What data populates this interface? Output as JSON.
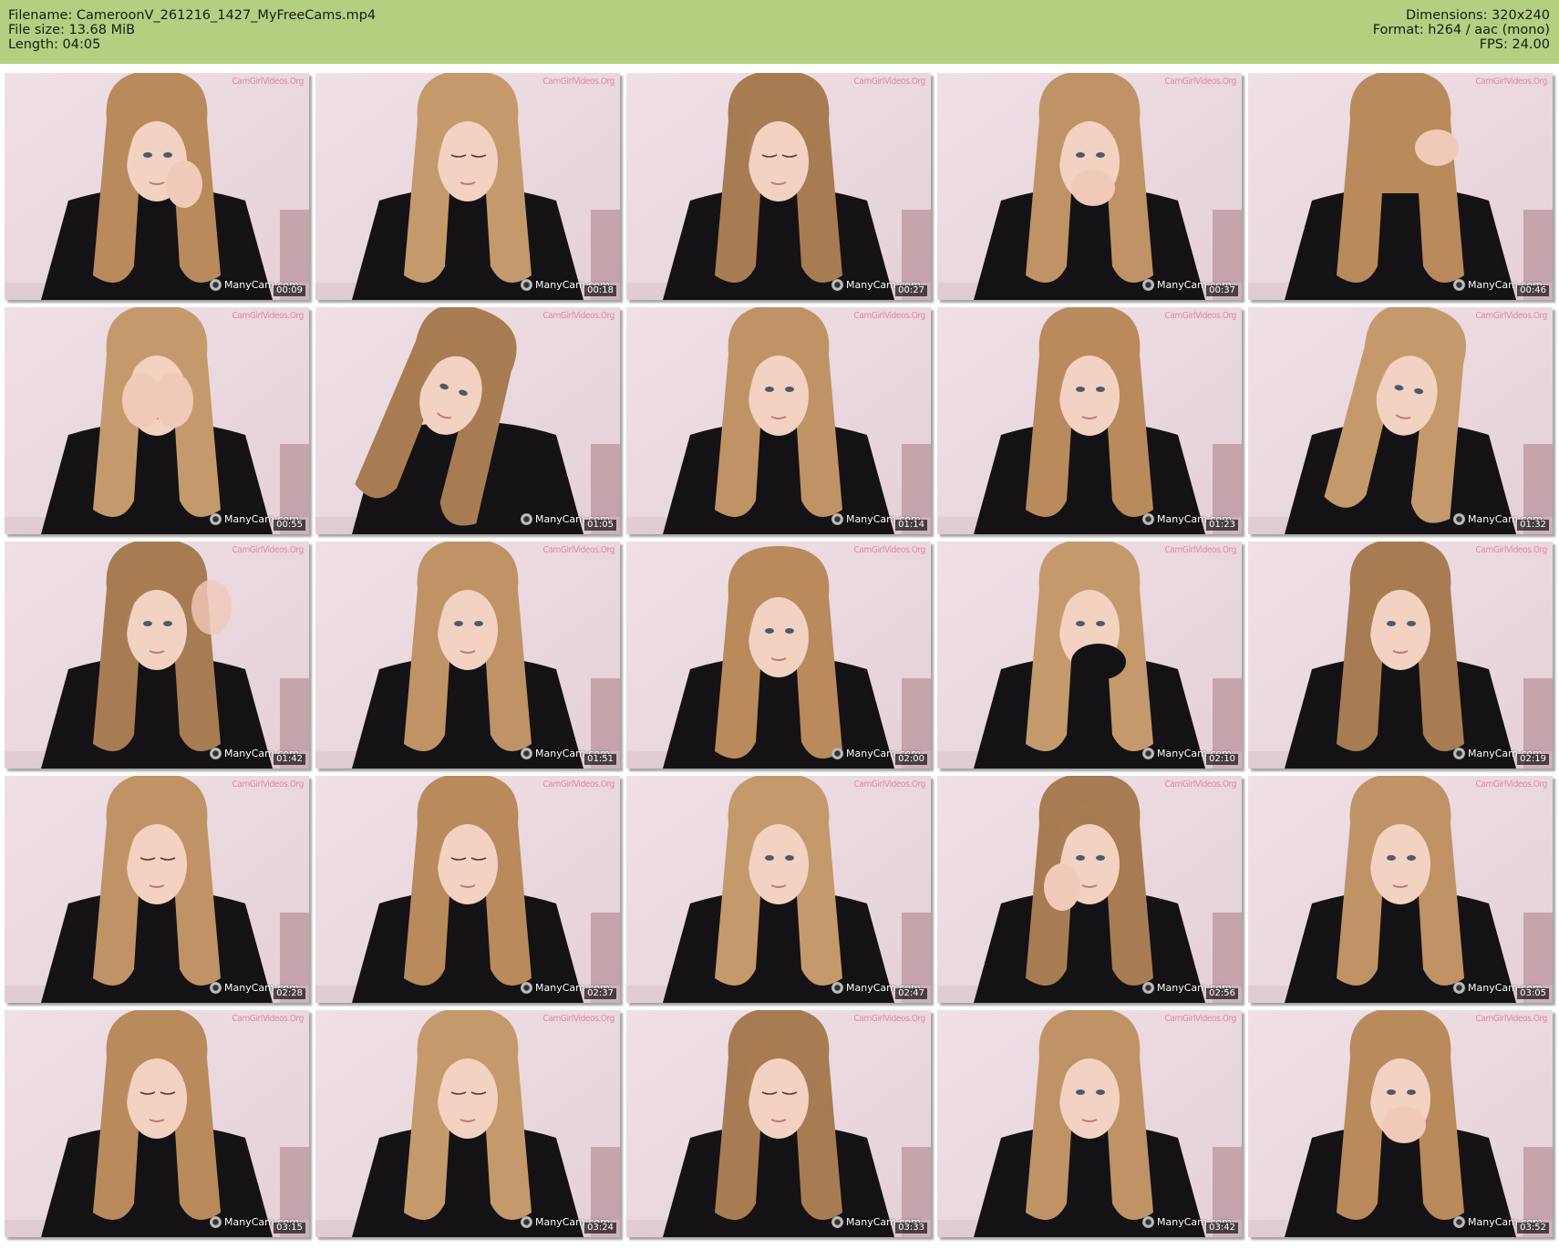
{
  "header": {
    "filename_line": "Filename: CameroonV_261216_1427_MyFreeCams.mp4",
    "filesize_line": "File size: 13.68 MiB",
    "length_line": "Length: 04:05",
    "dimensions_line": "Dimensions: 320x240",
    "format_line": "Format: h264 / aac (mono)",
    "fps_line": "FPS: 24.00",
    "bar_color": "#b3cf80"
  },
  "watermarks": {
    "top": "CamGirlVideos.Org",
    "bottom": "ManyCam.com"
  },
  "grid": {
    "columns": 5,
    "rows": 5
  },
  "thumbnails": [
    {
      "time": "00:09",
      "pose": "hand-cheek-right"
    },
    {
      "time": "00:18",
      "pose": "looking-down"
    },
    {
      "time": "00:27",
      "pose": "looking-down"
    },
    {
      "time": "00:37",
      "pose": "hand-mouth"
    },
    {
      "time": "00:46",
      "pose": "head-down-hand-hair"
    },
    {
      "time": "00:55",
      "pose": "hands-face"
    },
    {
      "time": "01:05",
      "pose": "hand-hair-tilt"
    },
    {
      "time": "01:14",
      "pose": "frontal"
    },
    {
      "time": "01:23",
      "pose": "frontal"
    },
    {
      "time": "01:32",
      "pose": "smile-tilt"
    },
    {
      "time": "01:42",
      "pose": "hand-hair-raised"
    },
    {
      "time": "01:51",
      "pose": "frontal"
    },
    {
      "time": "02:00",
      "pose": "frontal-low"
    },
    {
      "time": "02:10",
      "pose": "sleeve-mouth"
    },
    {
      "time": "02:19",
      "pose": "frontal"
    },
    {
      "time": "02:28",
      "pose": "looking-down"
    },
    {
      "time": "02:37",
      "pose": "looking-down"
    },
    {
      "time": "02:47",
      "pose": "frontal"
    },
    {
      "time": "02:56",
      "pose": "hand-cheek-left"
    },
    {
      "time": "03:05",
      "pose": "frontal"
    },
    {
      "time": "03:15",
      "pose": "looking-down"
    },
    {
      "time": "03:24",
      "pose": "looking-down"
    },
    {
      "time": "03:33",
      "pose": "eyes-closed"
    },
    {
      "time": "03:42",
      "pose": "frontal"
    },
    {
      "time": "03:52",
      "pose": "hand-mouth"
    }
  ]
}
